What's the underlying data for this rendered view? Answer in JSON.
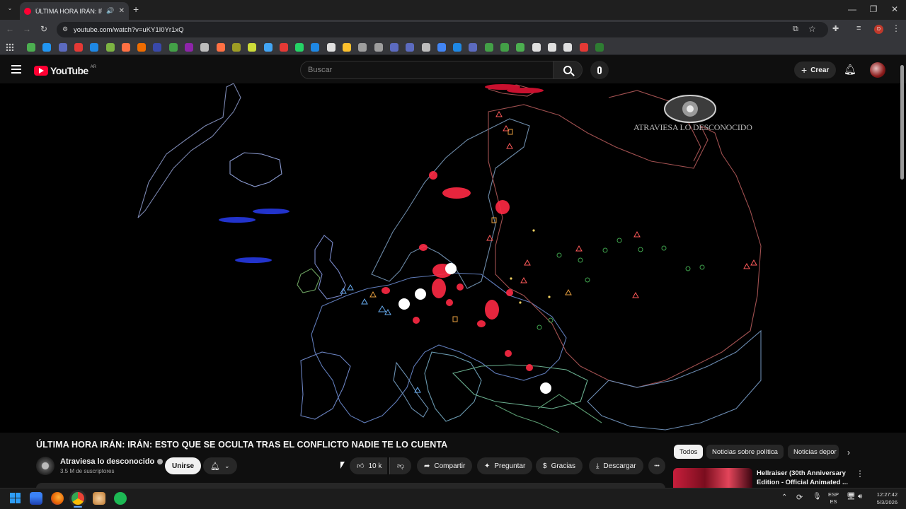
{
  "browser": {
    "tab_title": "ÚLTIMA HORA IRÁN: IRÁN:",
    "url": "youtube.com/watch?v=uKY1I0Yr1xQ",
    "new_tab": "+",
    "window": {
      "minimize": "—",
      "restore": "❐",
      "close": "✕"
    }
  },
  "youtube": {
    "logo": "YouTube",
    "region": "AR",
    "search_placeholder": "Buscar",
    "create_label": "Crear"
  },
  "video": {
    "watermark": "ATRAVIESA LO DESCONOCIDO",
    "title": "ÚLTIMA HORA IRÁN: IRÁN: ESTO QUE SE OCULTA TRAS EL CONFLICTO NADIE TE LO CUENTA",
    "channel_name": "Atraviesa lo desconocido",
    "subscribers": "3.5 M de suscriptores",
    "join_label": "Unirse",
    "like_count": "10 k",
    "share_label": "Compartir",
    "ask_label": "Preguntar",
    "thanks_label": "Gracias",
    "download_label": "Descargar",
    "more_label": "•••"
  },
  "recommendations": {
    "chips": [
      "Todos",
      "Noticias sobre política",
      "Noticias depor"
    ],
    "first_title_line1": "Hellraiser (30th Anniversary",
    "first_title_line2": "Edition - Official Animated ..."
  },
  "taskbar": {
    "lang_top": "ESP",
    "lang_bottom": "ES",
    "time": "12:27:42",
    "date": "5/3/2026"
  },
  "colors": {
    "youtube_red": "#ff0033",
    "map_red": "#ff2a44",
    "map_green": "#3fa34d",
    "map_blue": "#2233cc"
  }
}
